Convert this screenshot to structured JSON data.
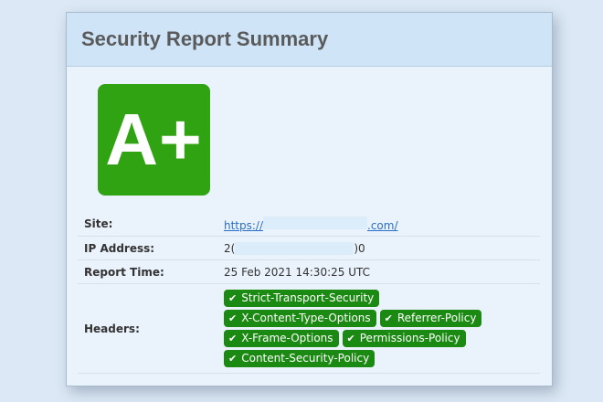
{
  "title": "Security Report Summary",
  "grade": "A+",
  "rows": {
    "site": {
      "label": "Site:",
      "prefix": "https://",
      "suffix": ".com/"
    },
    "ip": {
      "label": "IP Address:",
      "prefix": "2(",
      "suffix": ")0"
    },
    "time": {
      "label": "Report Time:",
      "value": "25 Feb 2021 14:30:25 UTC"
    },
    "headers": {
      "label": "Headers:"
    }
  },
  "headers_badges": [
    "Strict-Transport-Security",
    "X-Content-Type-Options",
    "Referrer-Policy",
    "X-Frame-Options",
    "Permissions-Policy",
    "Content-Security-Policy"
  ],
  "colors": {
    "grade_bg": "#2fa312",
    "badge_bg": "#1b8a12",
    "header_bg": "#cfe4f7"
  },
  "icons": {
    "badge_icon": "check-icon"
  }
}
